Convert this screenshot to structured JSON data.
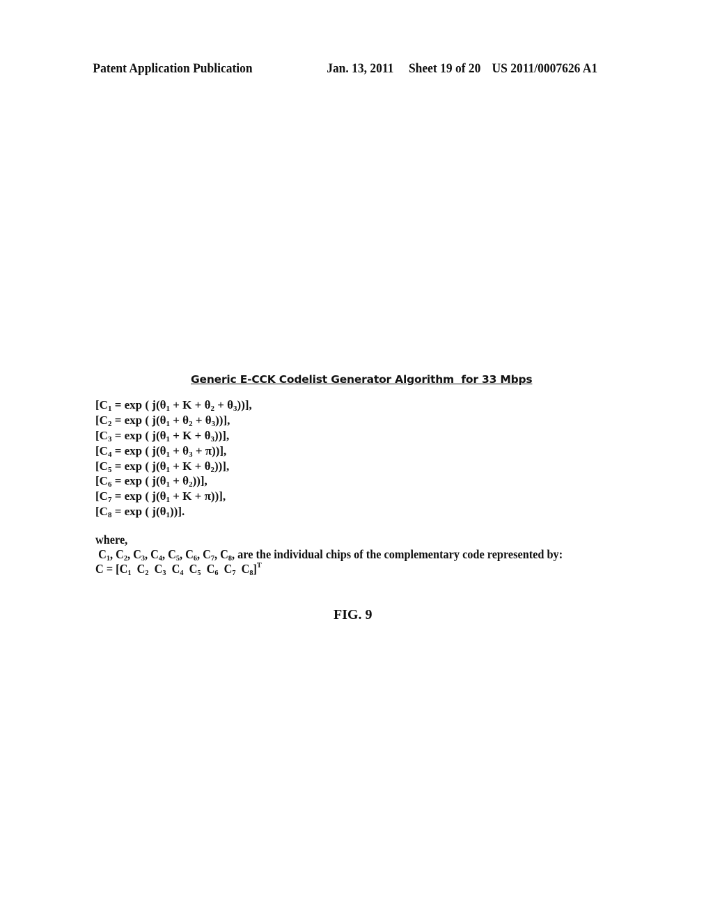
{
  "header": {
    "publication": "Patent Application Publication",
    "date": "Jan. 13, 2011",
    "sheet": "Sheet 19 of 20",
    "number": "US 2011/0007626 A1"
  },
  "figure": {
    "title": "Generic E-CCK Codelist Generator Algorithm  for 33 Mbps",
    "equations": [
      {
        "index": "1",
        "expr": "(θ1 + K + θ2 + θ3)",
        "end": "],"
      },
      {
        "index": "2",
        "expr": "(θ1 + θ2 + θ3)",
        "end": "],"
      },
      {
        "index": "3",
        "expr": "(θ1 + K + θ3)",
        "end": "],"
      },
      {
        "index": "4",
        "expr": "(θ1 + θ3 + π)",
        "end": "],"
      },
      {
        "index": "5",
        "expr": "(θ1 + K + θ2)",
        "end": "],"
      },
      {
        "index": "6",
        "expr": "(θ1 + θ2)",
        "end": "],"
      },
      {
        "index": "7",
        "expr": "(θ1 + K + π)",
        "end": "],"
      },
      {
        "index": "8",
        "expr": "(θ1)",
        "end": "]."
      }
    ],
    "where_label": "where,",
    "chips_text": "are the individual chips of the complementary code represented by:",
    "vector_prefix": "C = [",
    "vector_suffix": "T",
    "caption": "FIG. 9"
  }
}
